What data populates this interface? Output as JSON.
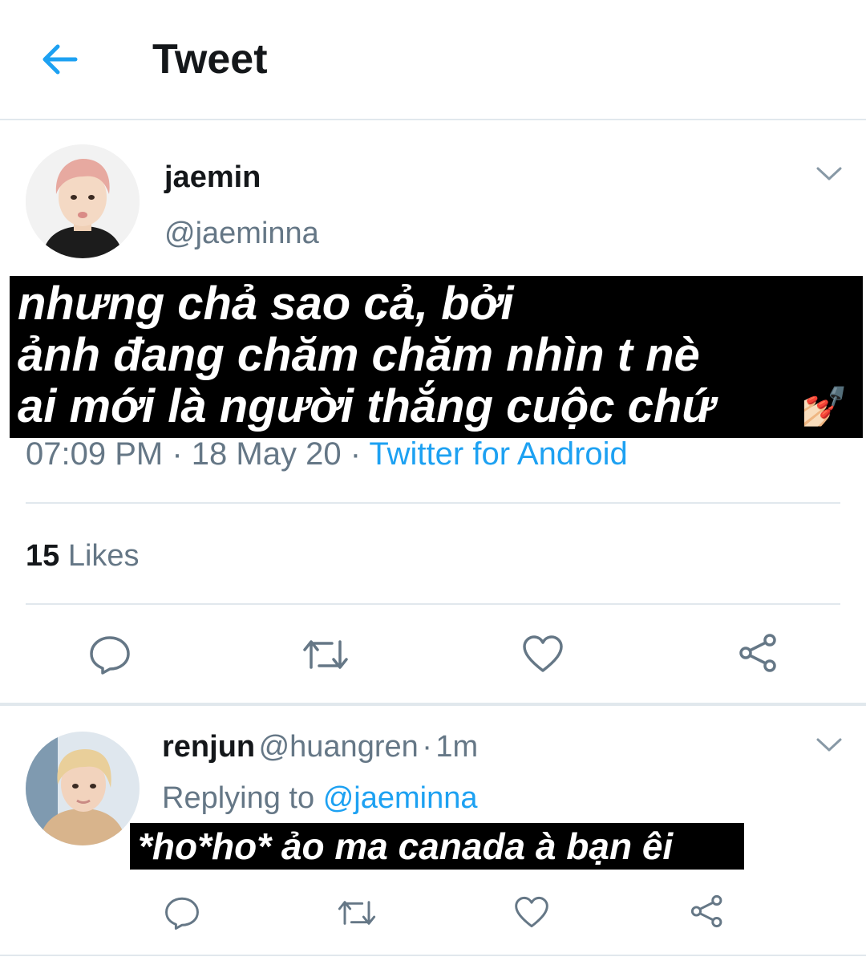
{
  "header": {
    "title": "Tweet",
    "back_icon": "arrow-left-icon"
  },
  "tweet": {
    "display_name": "jaemin",
    "handle": "@jaeminna",
    "caption_lines": [
      "nhưng chả sao cả, bởi",
      "ảnh đang chăm chăm nhìn t nè",
      "ai mới là người thắng cuộc chứ"
    ],
    "caption_emoji": "💅🏻",
    "time": "07:09 PM",
    "sep": "·",
    "date": "18 May 20",
    "source": "Twitter for Android",
    "likes_count": "15",
    "likes_label": "Likes"
  },
  "reply": {
    "display_name": "renjun",
    "handle": "@huangren",
    "sep": "·",
    "age": "1m",
    "replying_label": "Replying to",
    "replying_handle": "@jaeminna",
    "caption": "*ho*ho* ảo ma canada à bạn êi"
  },
  "colors": {
    "accent": "#1da1f2",
    "muted": "#657786",
    "divider": "#e1e8ed"
  }
}
